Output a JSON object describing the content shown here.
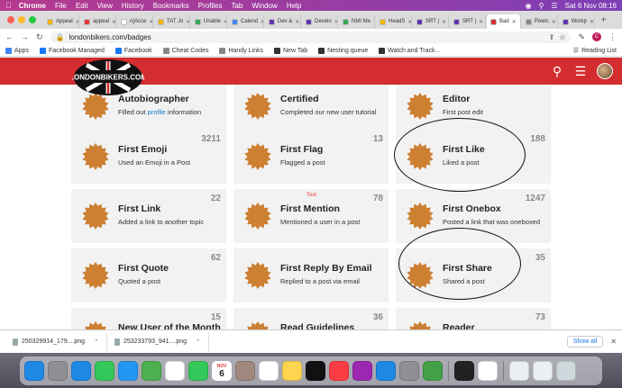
{
  "menubar": {
    "app": "Chrome",
    "items": [
      "File",
      "Edit",
      "View",
      "History",
      "Bookmarks",
      "Profiles",
      "Tab",
      "Window",
      "Help"
    ],
    "datetime": "Sat 6 Nov  08:16"
  },
  "tabs": [
    {
      "label": "Appeal",
      "color": "#f4b400"
    },
    {
      "label": "appeal",
      "color": "#e53935"
    },
    {
      "label": "n[Acce",
      "color": "#ffffff"
    },
    {
      "label": "TAT Jo",
      "color": "#f4b400"
    },
    {
      "label": "Unable",
      "color": "#34a853"
    },
    {
      "label": "Calend",
      "color": "#4285f4"
    },
    {
      "label": "Dev & ",
      "color": "#5e35b1"
    },
    {
      "label": "Develo",
      "color": "#5e35b1"
    },
    {
      "label": "NMI Me",
      "color": "#34a853"
    },
    {
      "label": "HeadS",
      "color": "#f4b400"
    },
    {
      "label": "SRT | ",
      "color": "#5e35b1"
    },
    {
      "label": "SRT | ",
      "color": "#5e35b1"
    },
    {
      "label": "Bad",
      "color": "#d32d2f",
      "active": true
    },
    {
      "label": "Pixelc",
      "color": "#888888"
    },
    {
      "label": "Workp",
      "color": "#5e35b1"
    }
  ],
  "address": {
    "url": "londonbikers.com/badges"
  },
  "bookmarks": [
    {
      "label": "Apps",
      "color": "#4285f4"
    },
    {
      "label": "Facebook Managed",
      "color": "#1877f2"
    },
    {
      "label": "Facebook",
      "color": "#1877f2"
    },
    {
      "label": "Cheat Codes",
      "color": "#888888"
    },
    {
      "label": "Handy Links",
      "color": "#888888"
    },
    {
      "label": "New Tab",
      "color": "#333333"
    },
    {
      "label": "Nesting queue",
      "color": "#333333"
    },
    {
      "label": "Watch and Track...",
      "color": "#333333"
    }
  ],
  "reading_list": "Reading List",
  "site": {
    "logo_text": "LONDONBIKERS.COM",
    "accent": "#d32d2f"
  },
  "badges": [
    {
      "name": "Autobiographer",
      "desc_pre": "Filled out ",
      "desc_link": "profile",
      "desc_post": " information",
      "count": ""
    },
    {
      "name": "Certified",
      "desc": "Completed our new user tutorial",
      "count": ""
    },
    {
      "name": "Editor",
      "desc": "First post edit",
      "count": ""
    },
    {
      "name": "First Emoji",
      "desc": "Used an Emoji in a Post",
      "count": "3211"
    },
    {
      "name": "First Flag",
      "desc": "Flagged a post",
      "count": "13"
    },
    {
      "name": "First Like",
      "desc": "Liked a post",
      "count": "188"
    },
    {
      "name": "First Link",
      "desc": "Added a link to another topic",
      "count": "22"
    },
    {
      "name": "First Mention",
      "desc": "Mentioned a user in a post",
      "count": "78"
    },
    {
      "name": "First Onebox",
      "desc": "Posted a link that was oneboxed",
      "count": "1247"
    },
    {
      "name": "First Quote",
      "desc": "Quoted a post",
      "count": "62"
    },
    {
      "name": "First Reply By Email",
      "desc": "Replied to a post via email",
      "count": ""
    },
    {
      "name": "First Share",
      "desc": "Shared a post",
      "count": "35"
    },
    {
      "name": "New User of the Month",
      "desc": "",
      "count": "15"
    },
    {
      "name": "Read Guidelines",
      "desc": "",
      "count": "36"
    },
    {
      "name": "Reader",
      "desc": "",
      "count": "73"
    }
  ],
  "annotation_label": "Text",
  "downloads": [
    {
      "name": "250329914_179....png"
    },
    {
      "name": "253233793_941....png"
    }
  ],
  "show_all": "Show all",
  "dock": {
    "calendar": {
      "month": "NOV",
      "day": "6"
    },
    "apps": [
      {
        "icon": "finder-icon",
        "color": "#1e88e5"
      },
      {
        "icon": "launchpad-icon",
        "color": "#8e8e93"
      },
      {
        "icon": "safari-icon",
        "color": "#1e88e5"
      },
      {
        "icon": "messages-icon",
        "color": "#34c759"
      },
      {
        "icon": "mail-icon",
        "color": "#2196f3"
      },
      {
        "icon": "maps-icon",
        "color": "#4caf50"
      },
      {
        "icon": "photos-icon",
        "color": "#ffffff"
      },
      {
        "icon": "facetime-icon",
        "color": "#34c759"
      },
      {
        "icon": "calendar-icon",
        "color": "#ffffff"
      },
      {
        "icon": "contacts-icon",
        "color": "#a1887f"
      },
      {
        "icon": "reminders-icon",
        "color": "#ffffff"
      },
      {
        "icon": "notes-icon",
        "color": "#ffd54f"
      },
      {
        "icon": "tv-icon",
        "color": "#111111"
      },
      {
        "icon": "music-icon",
        "color": "#fc3c44"
      },
      {
        "icon": "podcasts-icon",
        "color": "#9c27b0"
      },
      {
        "icon": "appstore-icon",
        "color": "#1e88e5"
      },
      {
        "icon": "settings-icon",
        "color": "#8e8e93"
      },
      {
        "icon": "activity-icon",
        "color": "#43a047"
      },
      {
        "icon": "terminal-icon",
        "color": "#222222"
      },
      {
        "icon": "chrome-icon",
        "color": "#ffffff"
      }
    ]
  }
}
